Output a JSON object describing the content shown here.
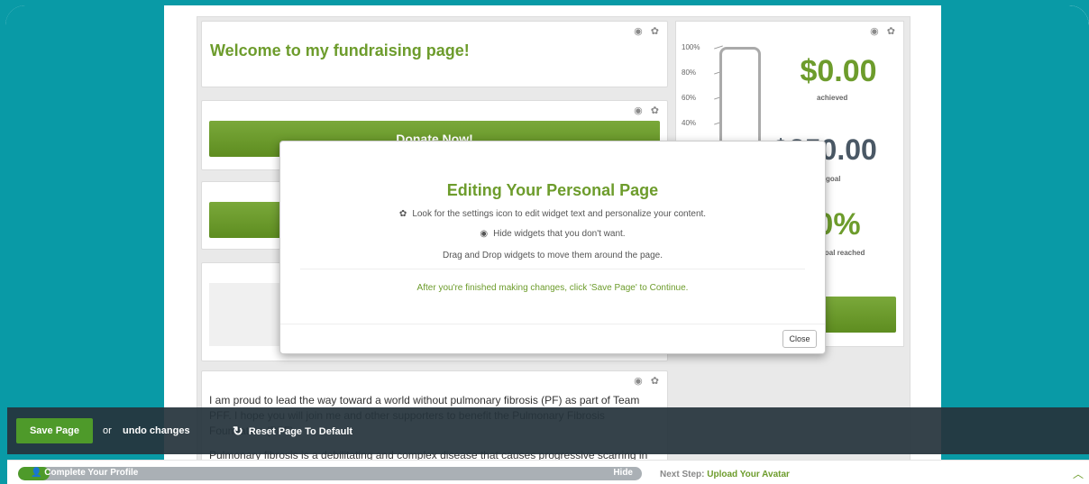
{
  "widgets": {
    "welcome_title": "Welcome to my fundraising page!",
    "donate_label": "Donate Now!",
    "story_text": "I am proud to lead the way toward a world without pulmonary fibrosis (PF) as part of Team PFF. I hope you will join me and other supporters to benefit the Pulmonary Fibrosis Foundation (PFF).",
    "story_text_2": "Pulmonary fibrosis is a debilitating and complex disease that causes progressive scarring in the lungs.",
    "widget_tools": "◉ ✿"
  },
  "thermometer": {
    "ticks": [
      "100%",
      "80%",
      "60%",
      "40%"
    ],
    "achieved_value": "$0.00",
    "achieved_label": "achieved",
    "goal_value": "$250.00",
    "goal_label": "goal",
    "percent_value": "0%",
    "percent_label": "goal reached",
    "progress_fraction": 0
  },
  "modal": {
    "title": "Editing Your Personal Page",
    "line1": "Look for the settings icon to edit widget text and personalize your content.",
    "line2": "Hide widgets that you don't want.",
    "line3": "Drag and Drop widgets to move them around the page.",
    "line4": "After you're finished making changes, click 'Save Page' to Continue.",
    "close_label": "Close"
  },
  "savebar": {
    "save_label": "Save Page",
    "or_text": "or",
    "undo_label": "undo changes",
    "reset_label": "Reset Page To Default"
  },
  "profile": {
    "label": "Complete Your Profile",
    "hide_label": "Hide",
    "progress_fraction": 0.05,
    "next_prefix": "Next Step:",
    "next_link": "Upload Your Avatar"
  },
  "colors": {
    "teal": "#099aa6",
    "green": "#6d9c2c",
    "slate": "#4a5865",
    "savebar": "#26343c"
  }
}
